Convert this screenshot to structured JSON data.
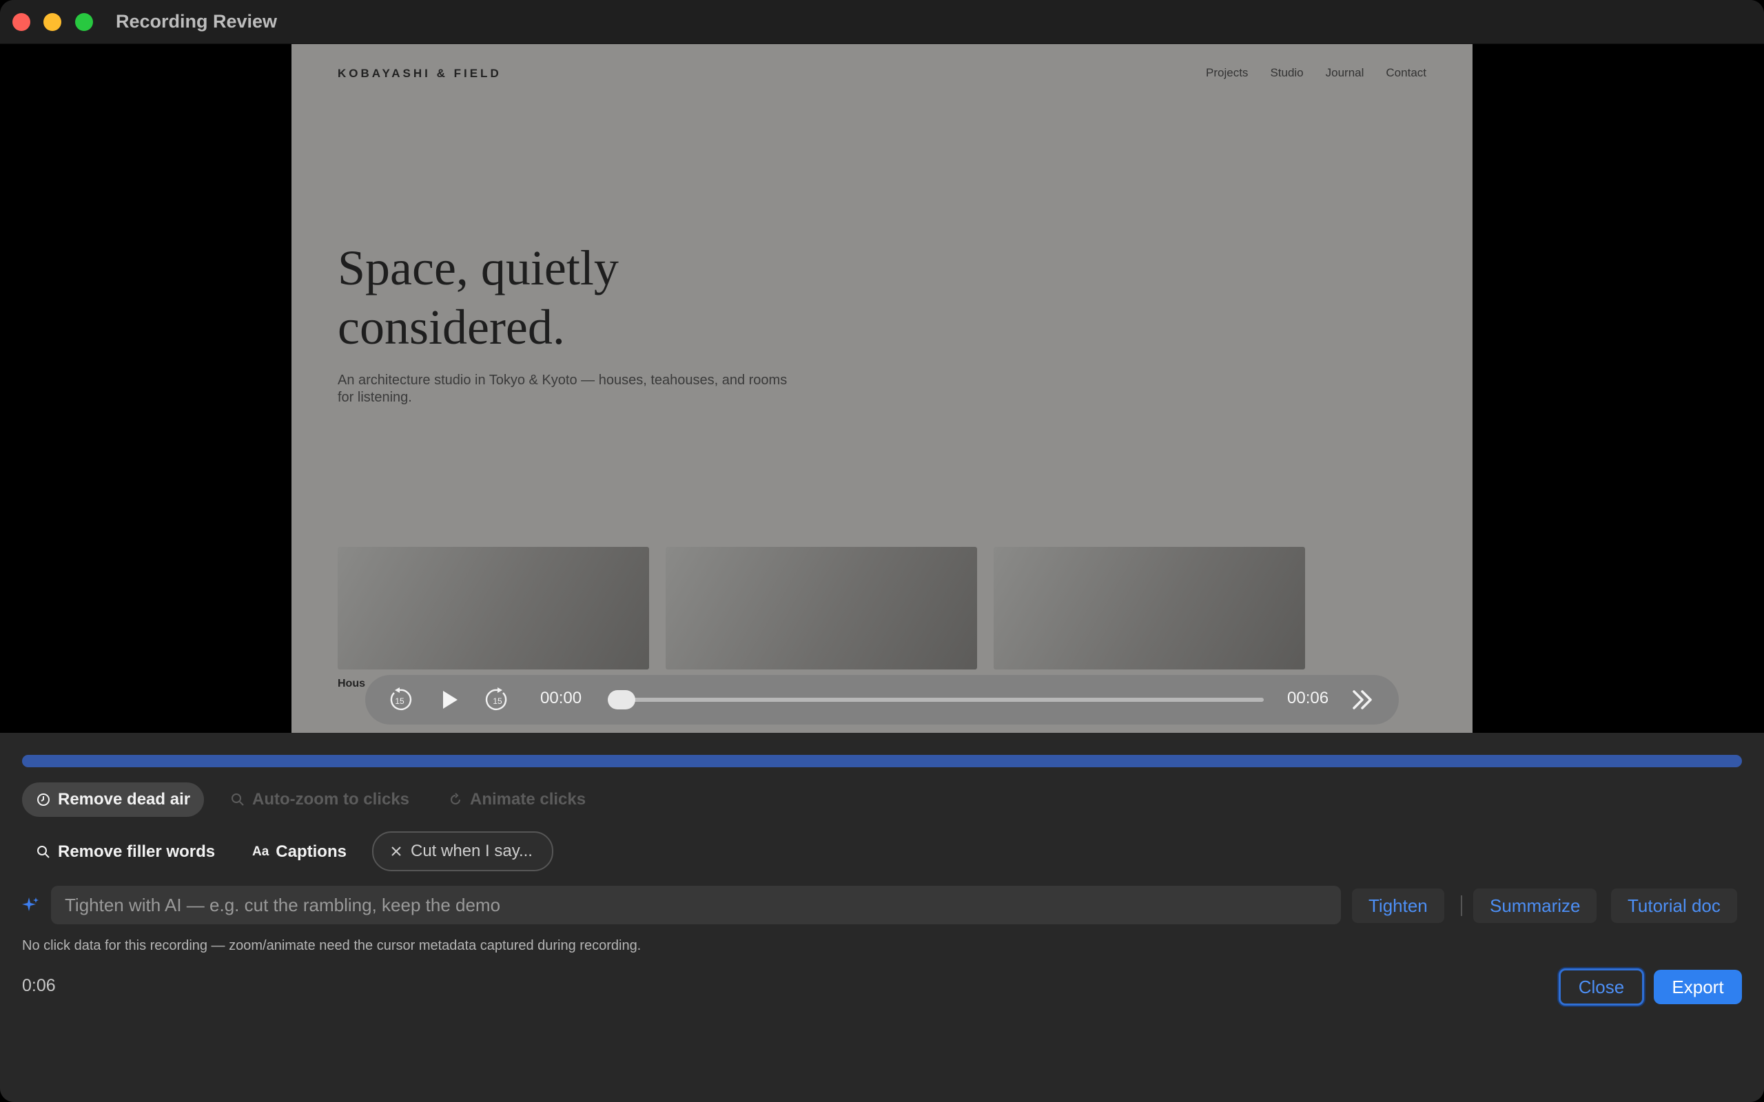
{
  "window": {
    "title": "Recording Review"
  },
  "site": {
    "brand": "KOBAYASHI & FIELD",
    "nav": [
      "Projects",
      "Studio",
      "Journal",
      "Contact"
    ],
    "hero_line1": "Space, quietly",
    "hero_line2": "considered.",
    "subtitle": "An architecture studio in Tokyo & Kyoto — houses, teahouses, and rooms for listening.",
    "thumb_label": "Hous"
  },
  "player": {
    "current_time": "00:00",
    "total_time": "00:06",
    "skip_back_seconds": "15",
    "skip_forward_seconds": "15",
    "position": 0
  },
  "progress": {
    "fraction": 1.0,
    "color": "#3458a8"
  },
  "options": {
    "remove_dead_air": "Remove dead air",
    "auto_zoom": "Auto-zoom to clicks",
    "animate_clicks": "Animate clicks",
    "remove_filler": "Remove filler words",
    "captions_icon_text": "Aa",
    "captions": "Captions",
    "cut_when_i_say": "Cut when I say..."
  },
  "ai": {
    "placeholder": "Tighten with AI — e.g. cut the rambling, keep the demo",
    "tighten": "Tighten",
    "summarize": "Summarize",
    "tutorial_doc": "Tutorial doc"
  },
  "note": "No click data for this recording — zoom/animate need the cursor metadata captured during recording.",
  "duration": "0:06",
  "actions": {
    "close": "Close",
    "export": "Export"
  },
  "colors": {
    "accent": "#2f80f0",
    "link": "#4d8ff5"
  }
}
